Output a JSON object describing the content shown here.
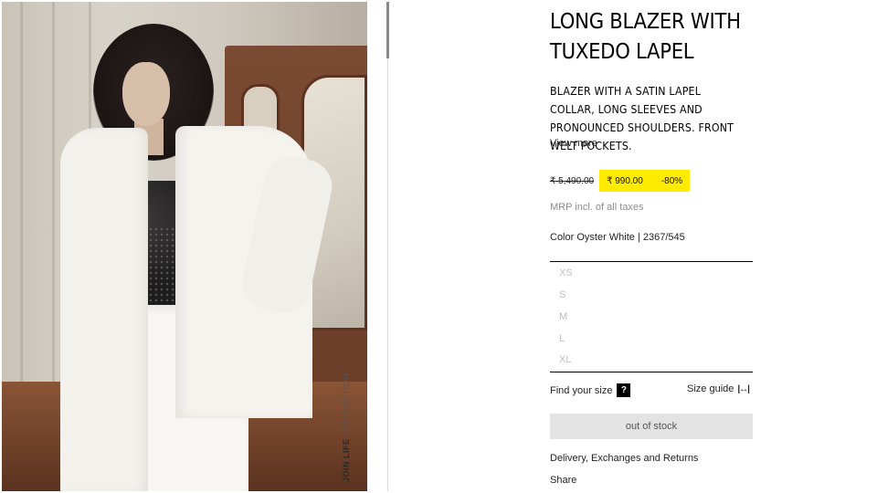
{
  "product": {
    "title": "LONG BLAZER WITH TUXEDO LAPEL",
    "description": "BLAZER WITH A SATIN LAPEL COLLAR, LONG SLEEVES AND PRONOUNCED SHOULDERS. FRONT WELT POCKETS.",
    "view_more": "View more",
    "old_price": "₹ 5,490.00",
    "sale_price": "₹ 990.00",
    "discount": "-80%",
    "mrp_note": "MRP incl. of all taxes",
    "color_line": "Color Oyster White | 2367/545",
    "sizes": [
      "XS",
      "S",
      "M",
      "L",
      "XL"
    ],
    "find_size_label": "Find your size",
    "find_size_badge": "?",
    "size_guide_label": "Size guide",
    "size_guide_icon": "|↔|",
    "button_label": "out of stock",
    "delivery_label": "Delivery, Exchanges and Returns",
    "share_label": "Share"
  },
  "photo": {
    "vertical_label_bold": "JOIN LIFE",
    "vertical_label_rest": " / COLLECTION"
  },
  "colors": {
    "sale_highlight": "#ffeb00",
    "disabled_size": "#bdbdbd",
    "button_bg": "#e3e3e3"
  }
}
